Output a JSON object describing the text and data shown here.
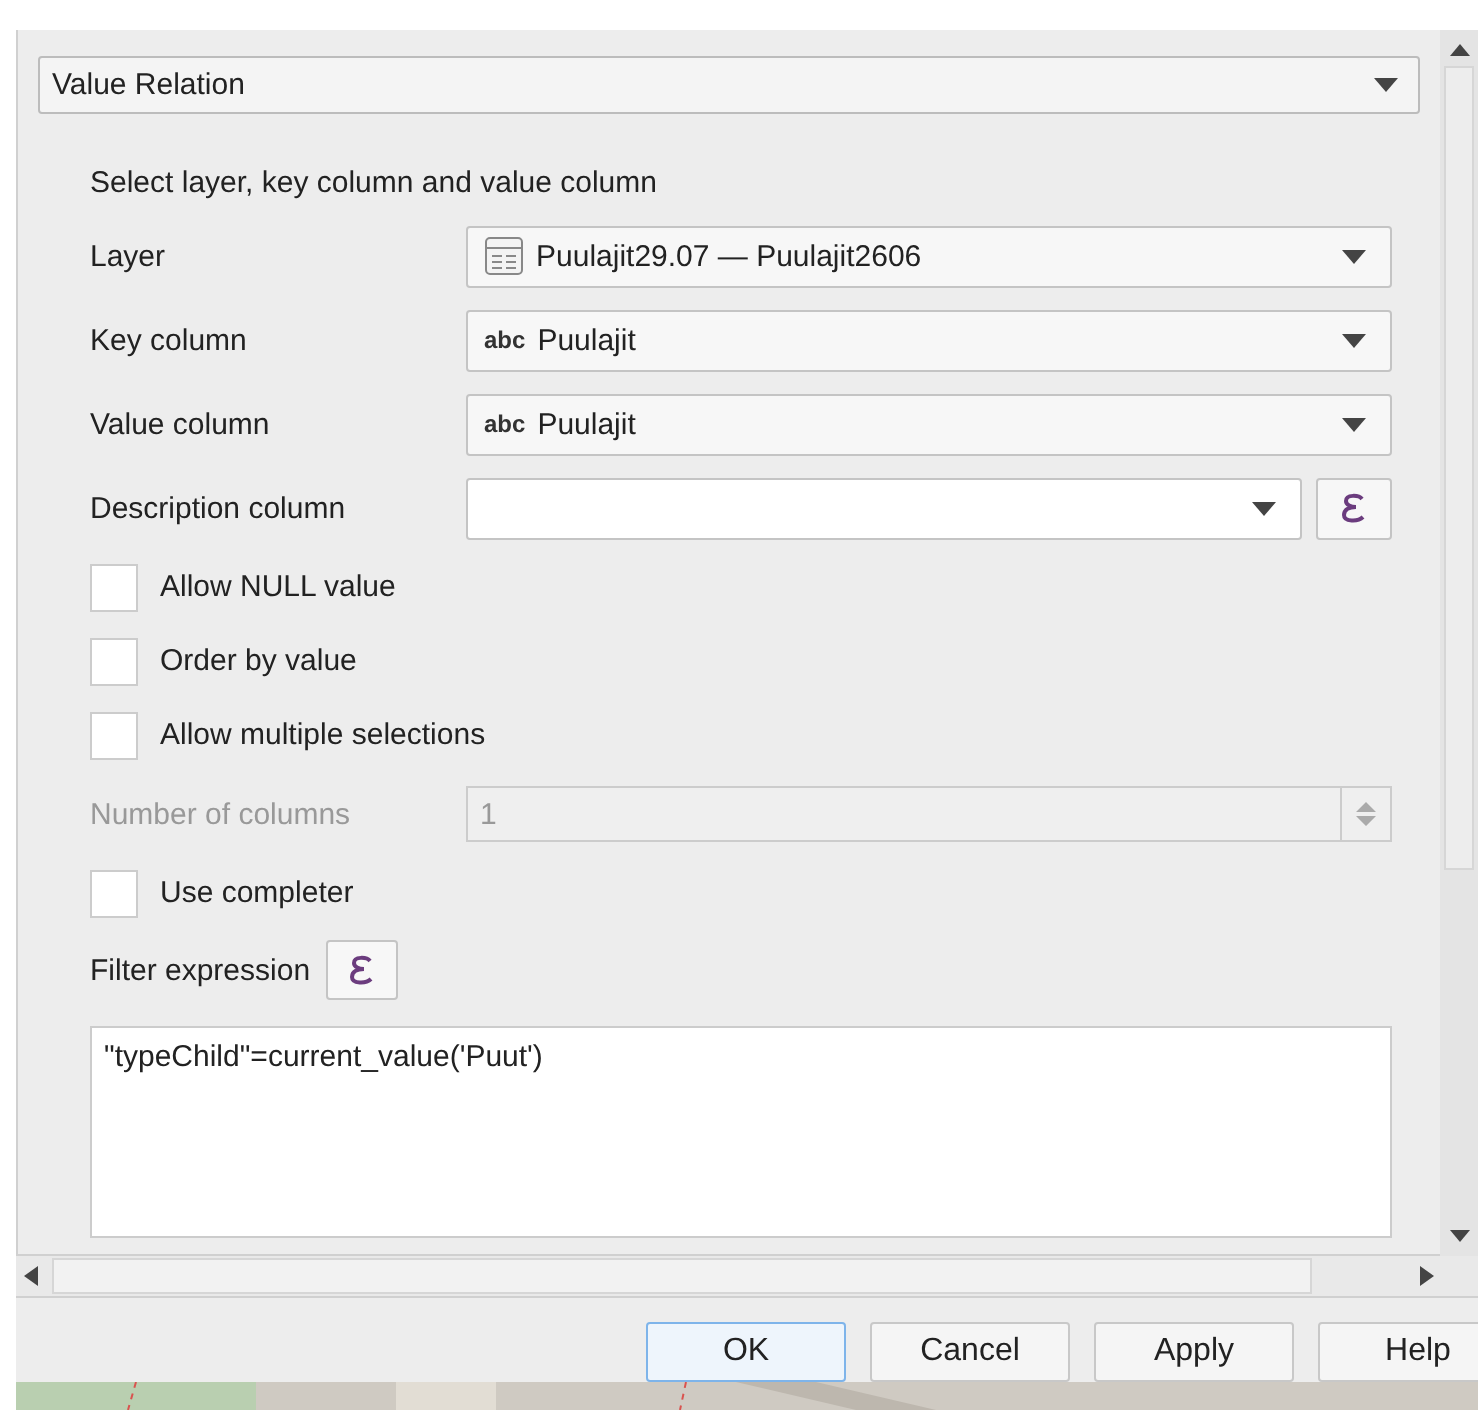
{
  "editor_type": {
    "value": "Value Relation"
  },
  "section_label": "Select layer, key column and value column",
  "rows": [
    {
      "kind": "layer-combo",
      "label": "Layer",
      "value": "Puulajit29.07 — Puulajit2606"
    },
    {
      "kind": "field-combo",
      "label": "Key column",
      "type_prefix": "abc",
      "value": "Puulajit"
    },
    {
      "kind": "field-combo",
      "label": "Value column",
      "type_prefix": "abc",
      "value": "Puulajit"
    },
    {
      "kind": "expression-combo",
      "label": "Description column"
    },
    {
      "kind": "checkbox",
      "label": "Allow NULL value",
      "checked": false
    },
    {
      "kind": "checkbox",
      "label": "Order by value",
      "checked": false
    },
    {
      "kind": "checkbox",
      "label": "Allow multiple selections",
      "checked": false
    },
    {
      "kind": "spin",
      "label": "Number of columns",
      "value": "1",
      "disabled": true
    },
    {
      "kind": "checkbox",
      "label": "Use completer",
      "checked": false
    }
  ],
  "filter": {
    "label": "Filter expression",
    "expression": "\"typeChild\"=current_value('Puut')"
  },
  "buttons": [
    {
      "label": "OK",
      "default": true
    },
    {
      "label": "Cancel",
      "default": false
    },
    {
      "label": "Apply",
      "default": false
    },
    {
      "label": "Help",
      "default": false
    }
  ]
}
